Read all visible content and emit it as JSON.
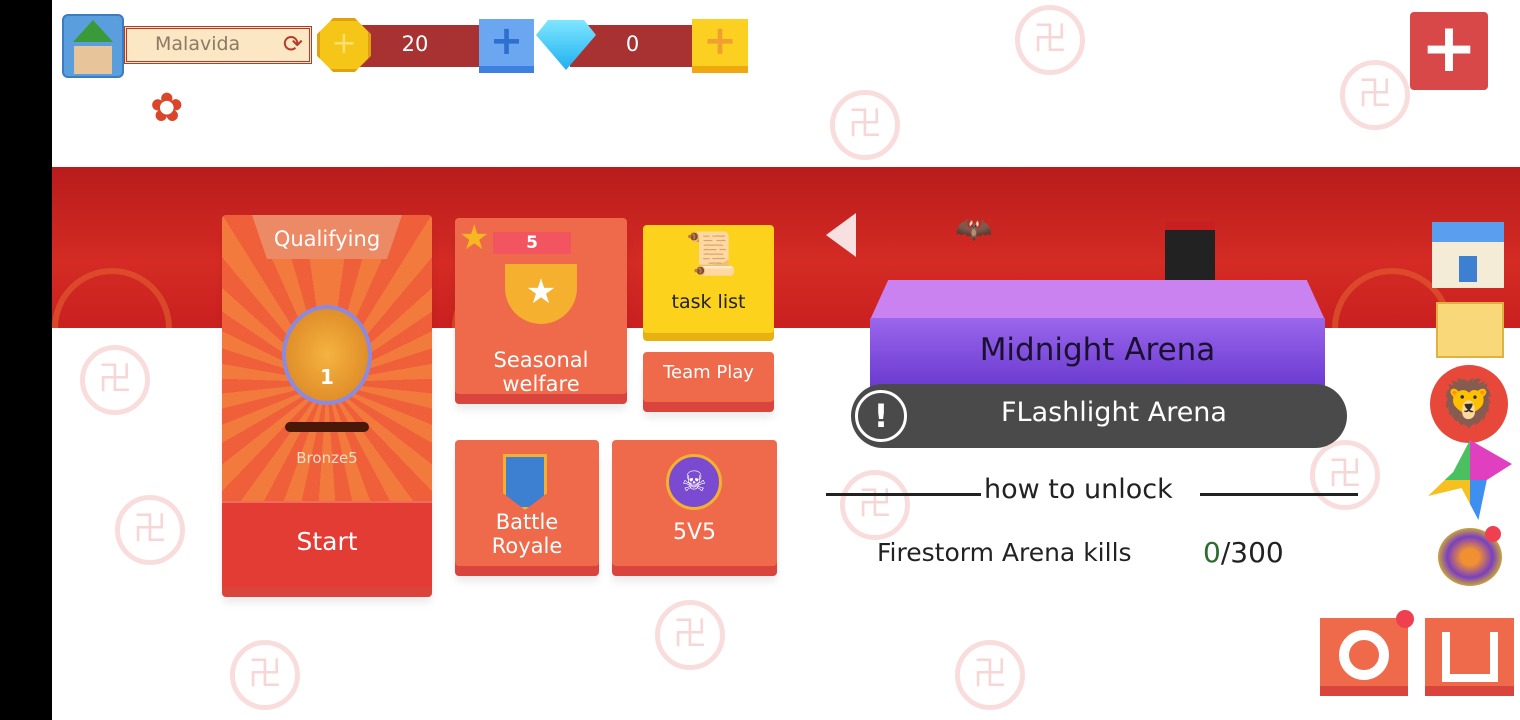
{
  "player": {
    "name": "Malavida"
  },
  "currency": {
    "coins": "20",
    "gems": "0"
  },
  "modes": {
    "qualifying": {
      "title": "Qualifying",
      "rank_number": "1",
      "rank": "Bronze5",
      "start": "Start"
    },
    "seasonal": {
      "stars": "5",
      "label_line1": "Seasonal",
      "label_line2": "welfare"
    },
    "task_list": "task list",
    "team_play": "Team Play",
    "battle_royale": {
      "line1": "Battle",
      "line2": "Royale"
    },
    "five_v_five": "5V5"
  },
  "arena": {
    "name": "Midnight Arena",
    "locked_name": "FLashlight Arena",
    "unlock_heading": "how to unlock",
    "requirement": "Firestorm Arena kills",
    "progress_current": "0",
    "progress_total": "/300"
  },
  "colors": {
    "accent": "#ef6a4a",
    "banner": "#d52b24",
    "arena": "#8a4fe0",
    "progress_green": "#2e6b2e"
  }
}
